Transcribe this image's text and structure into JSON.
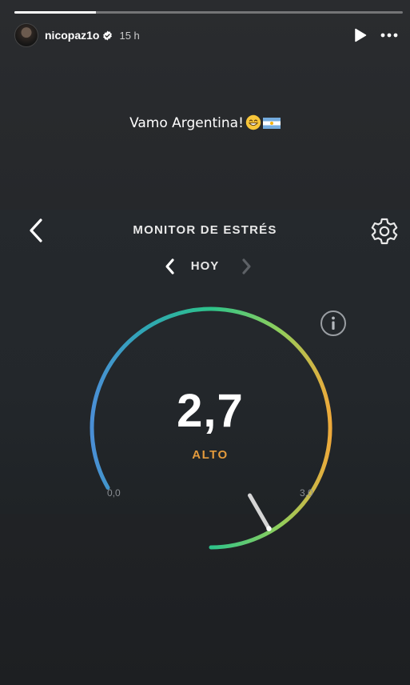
{
  "story": {
    "progress_fraction": 0.21,
    "username": "nicopaz1o",
    "verified": true,
    "time_ago": "15 h",
    "caption": "Vamo Argentina!",
    "caption_emojis": [
      "grinning-face-emoji",
      "argentina-flag-emoji"
    ]
  },
  "app": {
    "title": "MONITOR DE ESTRÉS",
    "day": "HOY",
    "value": "2,7",
    "level": "ALTO",
    "min_label": "0,0",
    "max_label": "3,0",
    "gauge": {
      "min": 0.0,
      "max": 3.0,
      "current": 2.7
    },
    "colors": {
      "low": "#4a8fd6",
      "mid": "#2ec38a",
      "high": "#f0a93a",
      "level_text": "#e39a3c"
    }
  },
  "icons": {
    "back": "chevron-left-icon",
    "settings": "gear-icon",
    "prev_day": "chevron-left-icon",
    "next_day": "chevron-right-icon",
    "info": "info-icon",
    "play": "play-icon",
    "more": "more-horizontal-icon",
    "verified": "verified-badge-icon"
  }
}
